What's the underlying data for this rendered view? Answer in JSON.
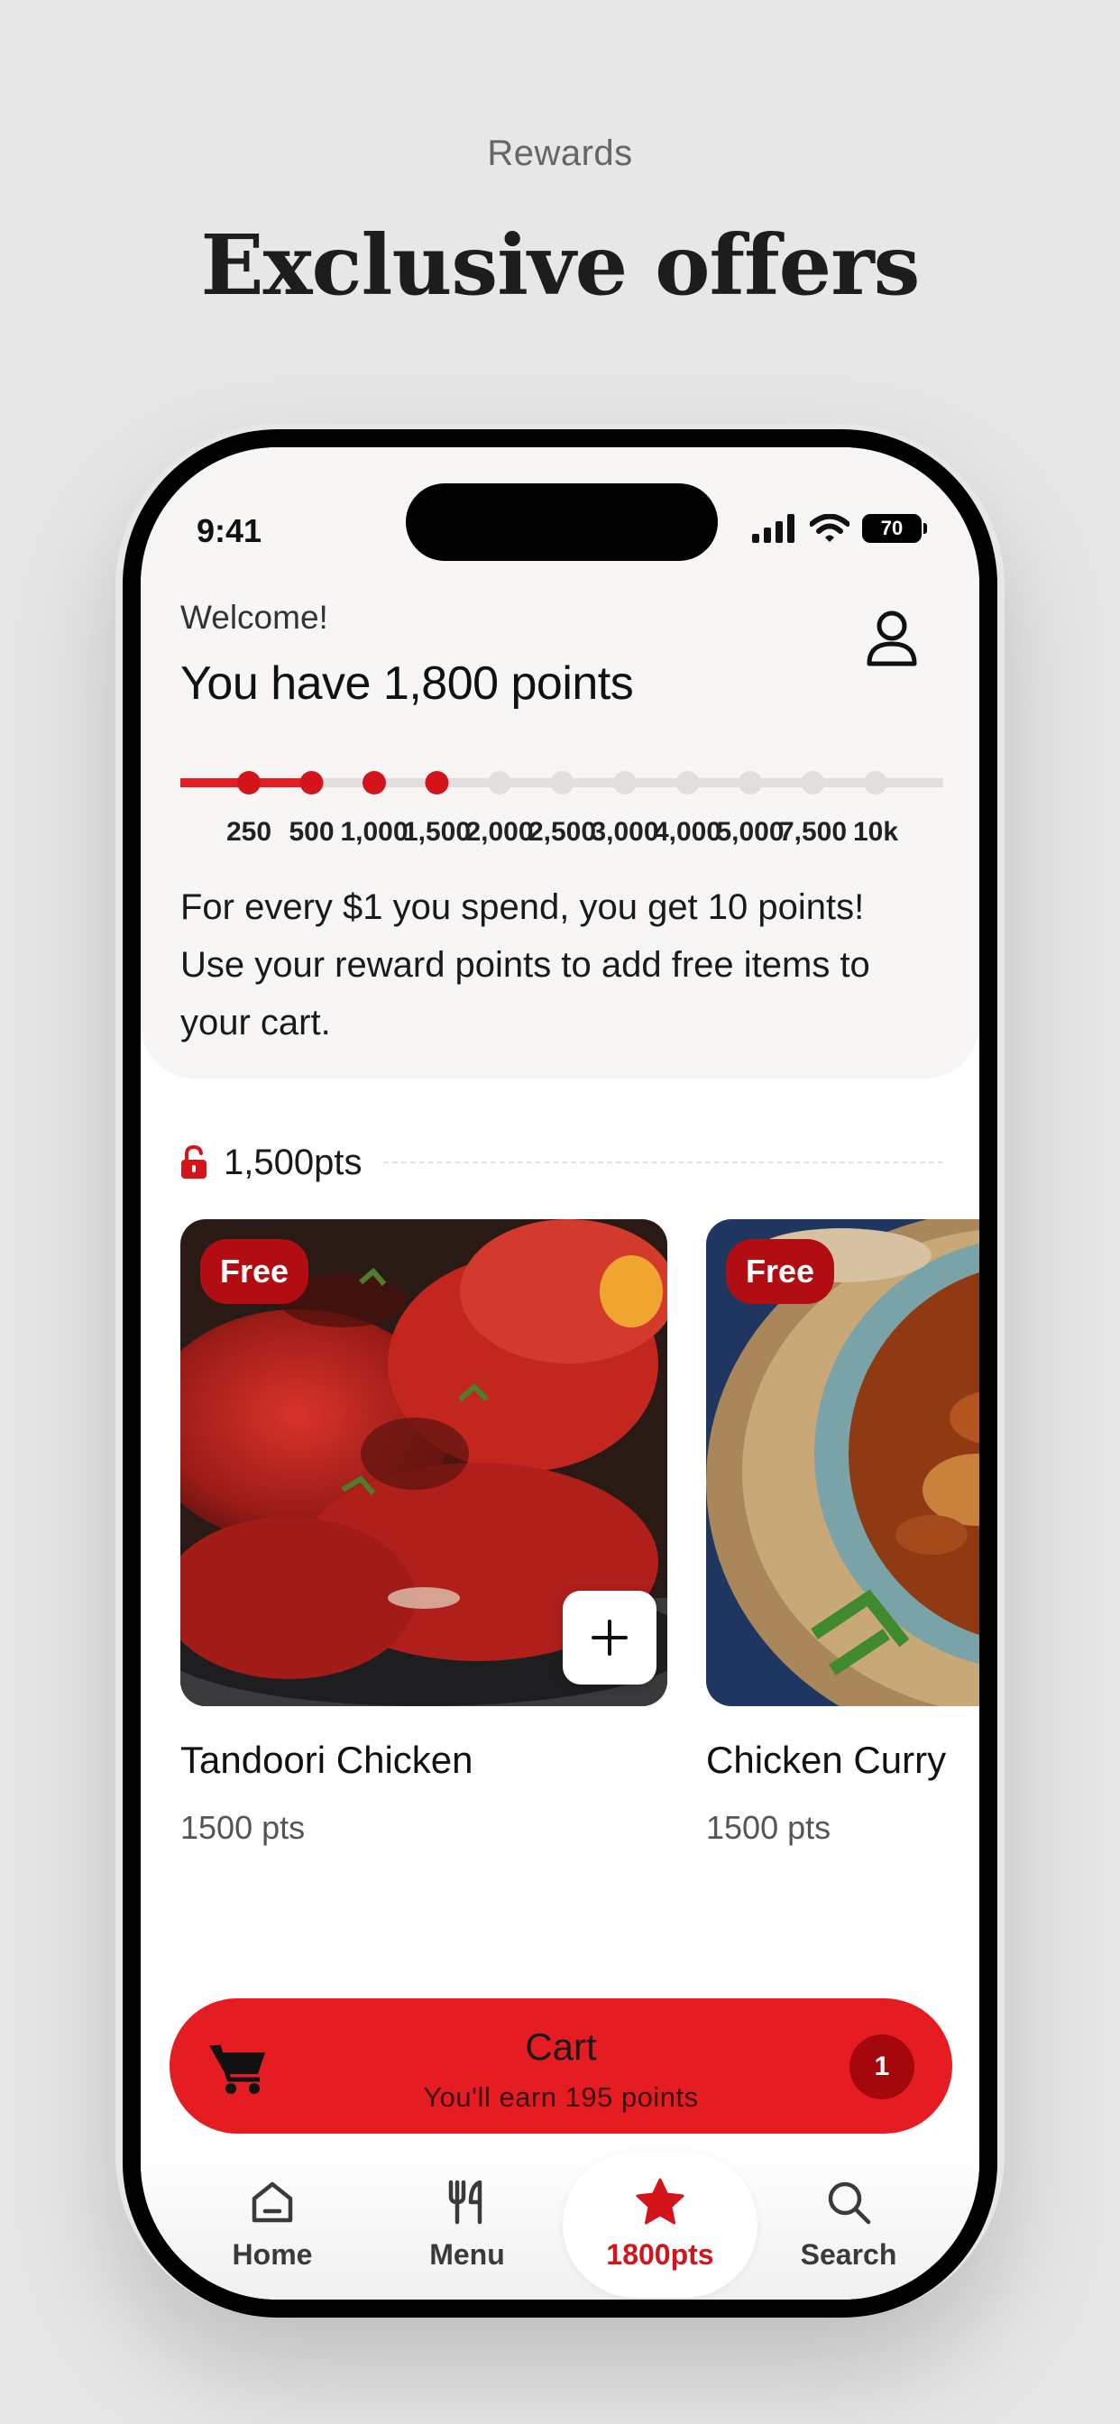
{
  "page": {
    "eyebrow": "Rewards",
    "headline": "Exclusive offers"
  },
  "status_bar": {
    "time": "9:41",
    "battery": "70"
  },
  "rewards": {
    "welcome": "Welcome!",
    "points_title": "You have 1,800 points",
    "current_points": 1800,
    "milestones": [
      "250",
      "500",
      "1,000",
      "1,500",
      "2,000",
      "2,500",
      "3,000",
      "4,000",
      "5,000",
      "7,500",
      "10k"
    ],
    "milestones_reached": 4,
    "copy": "For every $1 you spend, you get 10 points! Use your reward points to add free items to your cart."
  },
  "tier": {
    "label": "1,500pts",
    "icon": "unlocked-padlock-icon"
  },
  "items": [
    {
      "badge": "Free",
      "name": "Tandoori Chicken",
      "pts": "1500 pts"
    },
    {
      "badge": "Free",
      "name": "Chicken Curry",
      "pts": "1500 pts"
    }
  ],
  "cart": {
    "title": "Cart",
    "subtitle": "You'll earn 195 points",
    "count": "1"
  },
  "tabbar": {
    "tabs": [
      {
        "label": "Home",
        "icon": "home-icon"
      },
      {
        "label": "Menu",
        "icon": "fork-knife-icon"
      },
      {
        "label": "1800pts",
        "icon": "star-icon",
        "active": true
      },
      {
        "label": "Search",
        "icon": "search-icon"
      }
    ]
  },
  "colors": {
    "brand_red": "#e51c22",
    "dark_red": "#b10d12",
    "panel_bg": "#f8f5f5"
  }
}
